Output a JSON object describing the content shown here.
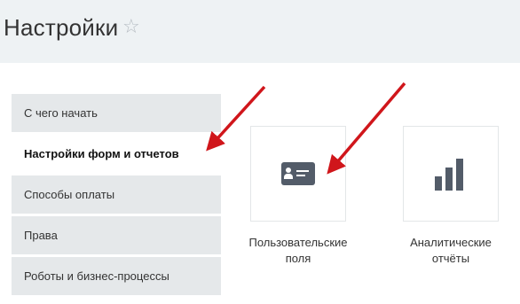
{
  "header": {
    "title": "Настройки",
    "star_glyph": "☆"
  },
  "menu": {
    "items": [
      {
        "label": "С чего начать",
        "active": false
      },
      {
        "label": "Настройки форм и отчетов",
        "active": true
      },
      {
        "label": "Способы оплаты",
        "active": false
      },
      {
        "label": "Права",
        "active": false
      },
      {
        "label": "Роботы и бизнес-процессы",
        "active": false
      }
    ]
  },
  "tiles": [
    {
      "icon": "contact-card-icon",
      "label_line1": "Пользовательские",
      "label_line2": "поля"
    },
    {
      "icon": "bar-chart-icon",
      "label_line1": "Аналитические",
      "label_line2": "отчёты"
    }
  ],
  "colors": {
    "header_bg": "#eef2f4",
    "menu_bg": "#e5e8ea",
    "icon": "#535c69",
    "arrow": "#d0161b"
  }
}
